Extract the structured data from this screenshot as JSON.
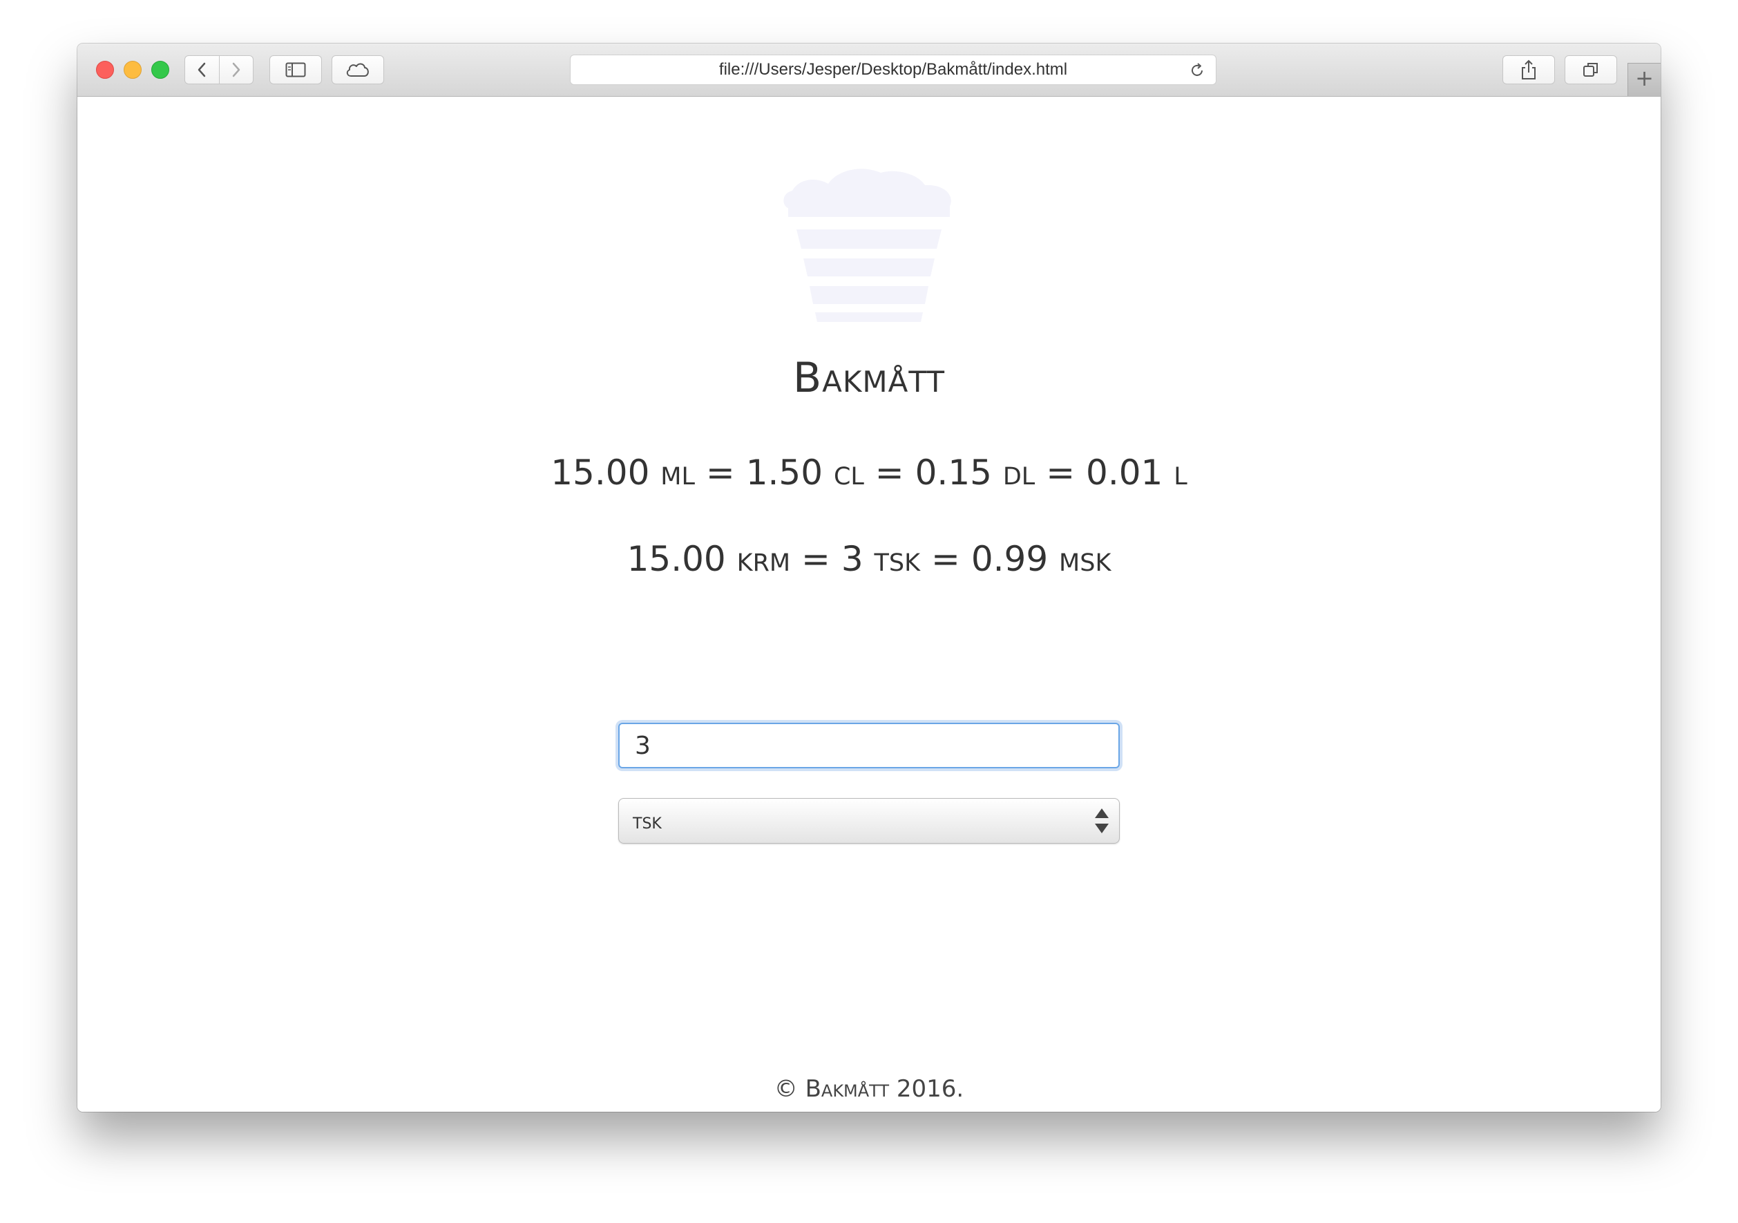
{
  "browser": {
    "url": "file:///Users/Jesper/Desktop/Bakmått/index.html",
    "new_tab_label": "+"
  },
  "app": {
    "logo_icon": "cupcake-icon",
    "title": "Bakmått"
  },
  "conversions": {
    "metric": [
      {
        "value": "15.00",
        "unit": "ml"
      },
      {
        "value": "1.50",
        "unit": "cl"
      },
      {
        "value": "0.15",
        "unit": "dl"
      },
      {
        "value": "0.01",
        "unit": "l"
      }
    ],
    "spoons": [
      {
        "value": "15.00",
        "unit": "krm"
      },
      {
        "value": "3",
        "unit": "tsk"
      },
      {
        "value": "0.99",
        "unit": "msk"
      }
    ],
    "separator": "="
  },
  "form": {
    "amount_value": "3",
    "unit_selected": "tsk"
  },
  "footer": {
    "text": "© Bakmått 2016."
  },
  "colors": {
    "logo_fill": "#f3f3fb",
    "text": "#333333",
    "focus_ring": "#6aa6e6"
  }
}
